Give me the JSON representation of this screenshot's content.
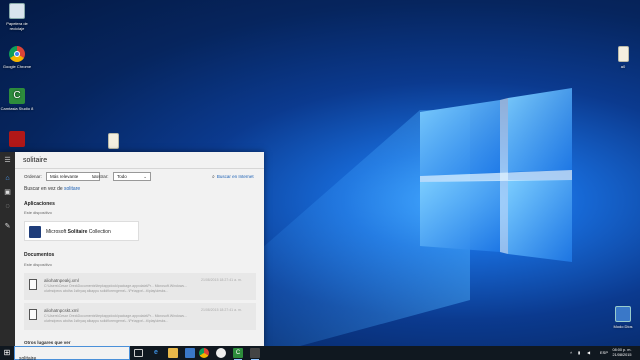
{
  "colors": {
    "accent": "#1a5fb4",
    "panel_bg": "#f2f2f2",
    "rail_bg": "#2b2b2b",
    "taskbar_bg": "#101820"
  },
  "desktop": {
    "icons": [
      {
        "name": "recycle-bin",
        "label": "Papelera de reciclaje",
        "icon": "recycle-bin-icon"
      },
      {
        "name": "google-chrome",
        "label": "Google Chrome",
        "icon": "chrome-icon"
      },
      {
        "name": "camtasia",
        "label": "Camtasia Studio 8",
        "icon": "camtasia-icon"
      },
      {
        "name": "red-app",
        "label": "",
        "icon": "app-icon"
      },
      {
        "name": "file",
        "label": "",
        "icon": "file-icon"
      },
      {
        "name": "top-right-file",
        "label": "a0",
        "icon": "file-icon"
      },
      {
        "name": "modo-dios",
        "label": "Modo Dios",
        "icon": "control-panel-icon"
      }
    ]
  },
  "search_panel": {
    "query": "solitaire",
    "filters": {
      "order_label": "Ordenar:",
      "order_value": "Más relevante",
      "show_label": "Mostrar:",
      "show_value": "Todo"
    },
    "web_search": "Buscar en Internet",
    "search_instead_prefix": "Buscar en vez de",
    "search_instead_term": "solitare",
    "apps_section": {
      "title": "Aplicaciones",
      "subtitle": "Este dispositivo",
      "result": {
        "prefix": "Microsoft",
        "bold": "Solitaire",
        "suffix": "Collection"
      }
    },
    "docs_section": {
      "title": "Documentos",
      "subtitle": "Este dispositivo",
      "results": [
        {
          "name": "aliohatnpeakj.xml",
          "path": "C:\\Users\\Cesar Orea\\Documents\\ltepkappdock\\package.appxdata\\Pr... Microsoft.Windows... olufmdpecs abdha 1sthyaq alkappu solidfiorengems\\...\\Pe\\appx\\...ti\\play\\desks...",
          "date": "21/08/2015 18:27:41 a. m."
        },
        {
          "name": "aliohatnpcskt.xml",
          "path": "C:\\Users\\Cesar Orea\\Documents\\ltepkappdock\\package.appxdata\\Pr... Microsoft.Windows... olufmdpecs abdha 1sthyaq alkappu solidfiorengems\\...\\Pe\\appx\\...ti\\play\\desks...",
          "date": "21/08/2015 18:27:41 a. m."
        }
      ]
    },
    "other_places": "Otros lugares que ver"
  },
  "taskbar": {
    "search_value": "solitaire",
    "apps": [
      "task-view-icon",
      "edge-icon",
      "file-explorer-icon",
      "store-icon",
      "camtasia-taskbar-icon",
      "chrome-taskbar-icon",
      "media-icon",
      "camtasia-running-icon",
      "app-running-icon"
    ],
    "language": "ESP",
    "time": "08:00 p. m.",
    "date": "21/08/2015"
  }
}
